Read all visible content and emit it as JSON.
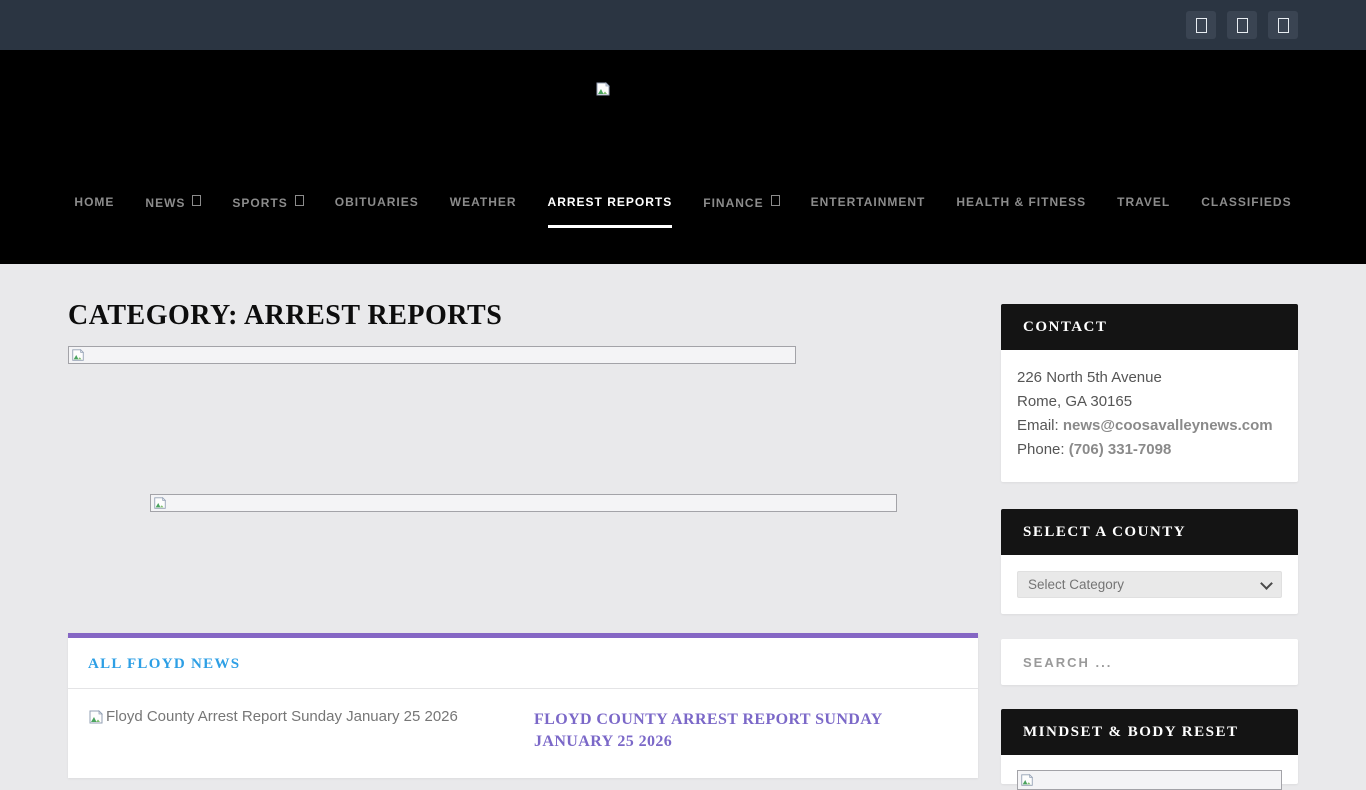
{
  "topbar": {
    "social": [
      {
        "name": "social-link-1"
      },
      {
        "name": "social-link-2"
      },
      {
        "name": "social-link-3"
      }
    ]
  },
  "nav": {
    "items": [
      {
        "label": "HOME",
        "dropdown": false,
        "active": false
      },
      {
        "label": "NEWS",
        "dropdown": true,
        "active": false
      },
      {
        "label": "SPORTS",
        "dropdown": true,
        "active": false
      },
      {
        "label": "OBITUARIES",
        "dropdown": false,
        "active": false
      },
      {
        "label": "WEATHER",
        "dropdown": false,
        "active": false
      },
      {
        "label": "ARREST REPORTS",
        "dropdown": false,
        "active": true
      },
      {
        "label": "FINANCE",
        "dropdown": true,
        "active": false
      },
      {
        "label": "ENTERTAINMENT",
        "dropdown": false,
        "active": false
      },
      {
        "label": "HEALTH & FITNESS",
        "dropdown": false,
        "active": false
      },
      {
        "label": "TRAVEL",
        "dropdown": false,
        "active": false
      },
      {
        "label": "CLASSIFIEDS",
        "dropdown": false,
        "active": false
      }
    ]
  },
  "page": {
    "title": "CATEGORY: ARREST REPORTS"
  },
  "feed": {
    "section_title": "ALL FLOYD NEWS",
    "article": {
      "image_alt": "Floyd County Arrest Report Sunday January 25 2026",
      "title": "FLOYD COUNTY ARREST REPORT SUNDAY JANUARY 25 2026"
    }
  },
  "sidebar": {
    "contact": {
      "title": "CONTACT",
      "address_line1": "226 North 5th Avenue",
      "address_line2": "Rome, GA 30165",
      "email_label": "Email:",
      "email": "news@coosavalleynews.com",
      "phone_label": "Phone:",
      "phone": "(706) 331-7098"
    },
    "county": {
      "title": "SELECT A COUNTY",
      "select_value": "Select Category"
    },
    "search": {
      "placeholder": "SEARCH ..."
    },
    "mindset": {
      "title": "MINDSET & BODY RESET"
    }
  },
  "colors": {
    "topbar_bg": "#2b3542",
    "header_bg": "#000000",
    "page_bg": "#e9e9eb",
    "accent_purple": "#8566c4",
    "section_link_blue": "#2d9fe5",
    "article_link_purple": "#7b68c8",
    "widget_header_bg": "#141414"
  }
}
